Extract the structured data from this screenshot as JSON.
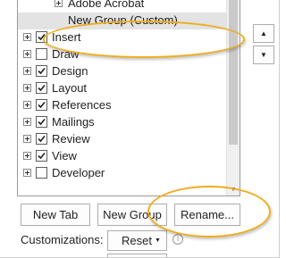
{
  "tree": {
    "items": [
      {
        "label": "Adobe Acrobat",
        "level": 1,
        "expander": true,
        "checkbox": "none"
      },
      {
        "label": "New Group (Custom)",
        "level": 1,
        "expander": false,
        "checkbox": "none",
        "selected": true
      },
      {
        "label": "Insert",
        "level": 0,
        "expander": true,
        "checkbox": "checked"
      },
      {
        "label": "Draw",
        "level": 0,
        "expander": true,
        "checkbox": "unchecked"
      },
      {
        "label": "Design",
        "level": 0,
        "expander": true,
        "checkbox": "checked"
      },
      {
        "label": "Layout",
        "level": 0,
        "expander": true,
        "checkbox": "checked"
      },
      {
        "label": "References",
        "level": 0,
        "expander": true,
        "checkbox": "checked"
      },
      {
        "label": "Mailings",
        "level": 0,
        "expander": true,
        "checkbox": "checked"
      },
      {
        "label": "Review",
        "level": 0,
        "expander": true,
        "checkbox": "checked"
      },
      {
        "label": "View",
        "level": 0,
        "expander": true,
        "checkbox": "checked"
      },
      {
        "label": "Developer",
        "level": 0,
        "expander": true,
        "checkbox": "unchecked"
      }
    ]
  },
  "move_buttons": {
    "up_icon": "triangle-up-icon",
    "down_icon": "triangle-down-icon"
  },
  "buttons": {
    "new_tab": "New Tab",
    "new_group": "New Group",
    "rename": "Rename..."
  },
  "customizations": {
    "label": "Customizations:",
    "reset": "Reset"
  },
  "colors": {
    "callout": "#f0ad1e",
    "selection": "#e3e3e3"
  }
}
